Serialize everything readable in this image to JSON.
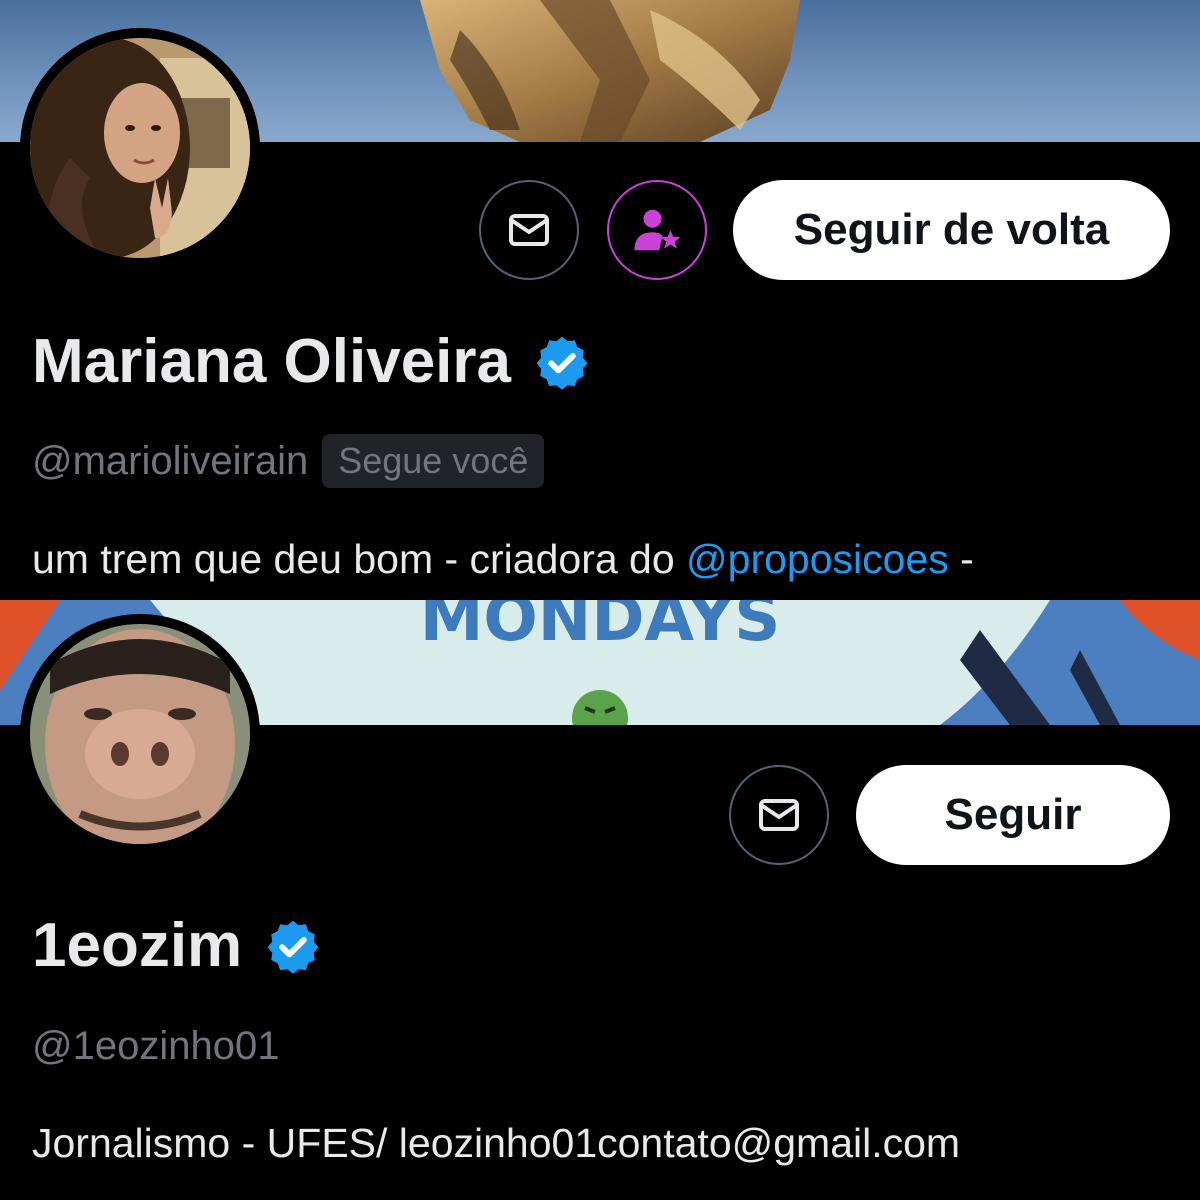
{
  "profiles": [
    {
      "display_name": "Mariana Oliveira",
      "handle": "@marioliveirain",
      "follows_you_badge": "Segue você",
      "follow_button": "Seguir de volta",
      "bio_before": "um trem que deu bom - criadora do ",
      "bio_mention": "@proposicoes",
      "bio_after": " -",
      "icons": [
        "envelope-icon",
        "user-star-icon",
        "verified-badge-icon"
      ]
    },
    {
      "display_name": "1eozim",
      "handle": "@1eozinho01",
      "follow_button": "Seguir",
      "bio": "Jornalismo - UFES/ leozinho01contato@gmail.com",
      "banner_text": "MONDAYS",
      "icons": [
        "envelope-icon",
        "verified-badge-icon"
      ]
    }
  ],
  "colors": {
    "background": "#000000",
    "text_primary": "#e7e9ea",
    "text_secondary": "#71767b",
    "accent_blue": "#1d9bf0",
    "promo_magenta": "#c941d8",
    "button_bg": "#ffffff"
  }
}
